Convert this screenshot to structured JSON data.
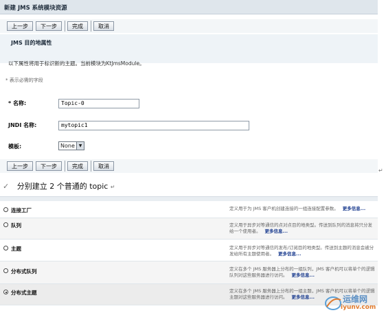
{
  "page": {
    "title": "新建 JMS 系统模块资源",
    "buttons": {
      "back": "上一步",
      "next": "下一步",
      "finish": "完成",
      "cancel": "取消"
    }
  },
  "section": {
    "title": "JMS 目的地属性",
    "description": "以下属性将用于标识新的主题。当前模块为KtJmsModule。",
    "required_note": "* 表示必需的字段"
  },
  "form": {
    "name_label": "* 名称:",
    "name_value": "Topic-0",
    "jndi_label": "JNDI 名称:",
    "jndi_value": "mytopic1",
    "template_label": "模板:",
    "template_value": "None"
  },
  "caption": {
    "tick": "✓",
    "text": "分别建立 2 个普通的 topic",
    "mark": "↵"
  },
  "resource_types": [
    {
      "label": "连接工厂",
      "selected": false,
      "desc": "定义用于为 JMS 客户机创建连接的一组连接配置参数。",
      "more": "更多信息..."
    },
    {
      "label": "队列",
      "selected": false,
      "desc": "定义用于异步对等通信的点对点目的地类型。传送到队列的消息将只分发给一个使用者。",
      "more": "更多信息..."
    },
    {
      "label": "主题",
      "selected": false,
      "desc": "定义用于异步对等通信的发布/订阅目的地类型。传送到主题的消息会被分发给所有主题使用者。",
      "more": "更多信息..."
    },
    {
      "label": "分布式队列",
      "selected": false,
      "desc": "定义在多个 JMS 服务器上分布的一组队列，JMS 客户机可以将单个的逻辑队列对这些服务器进行访问。",
      "more": "更多信息..."
    },
    {
      "label": "分布式主题",
      "selected": true,
      "desc": "定义在多个 JMS 服务器上分布的一组主题，JMS 客户机可以将单个的逻辑主题对这些服务器进行访问。",
      "more": "更多信息..."
    }
  ],
  "watermark": {
    "cn": "运维网",
    "en": "iyunv.com"
  }
}
